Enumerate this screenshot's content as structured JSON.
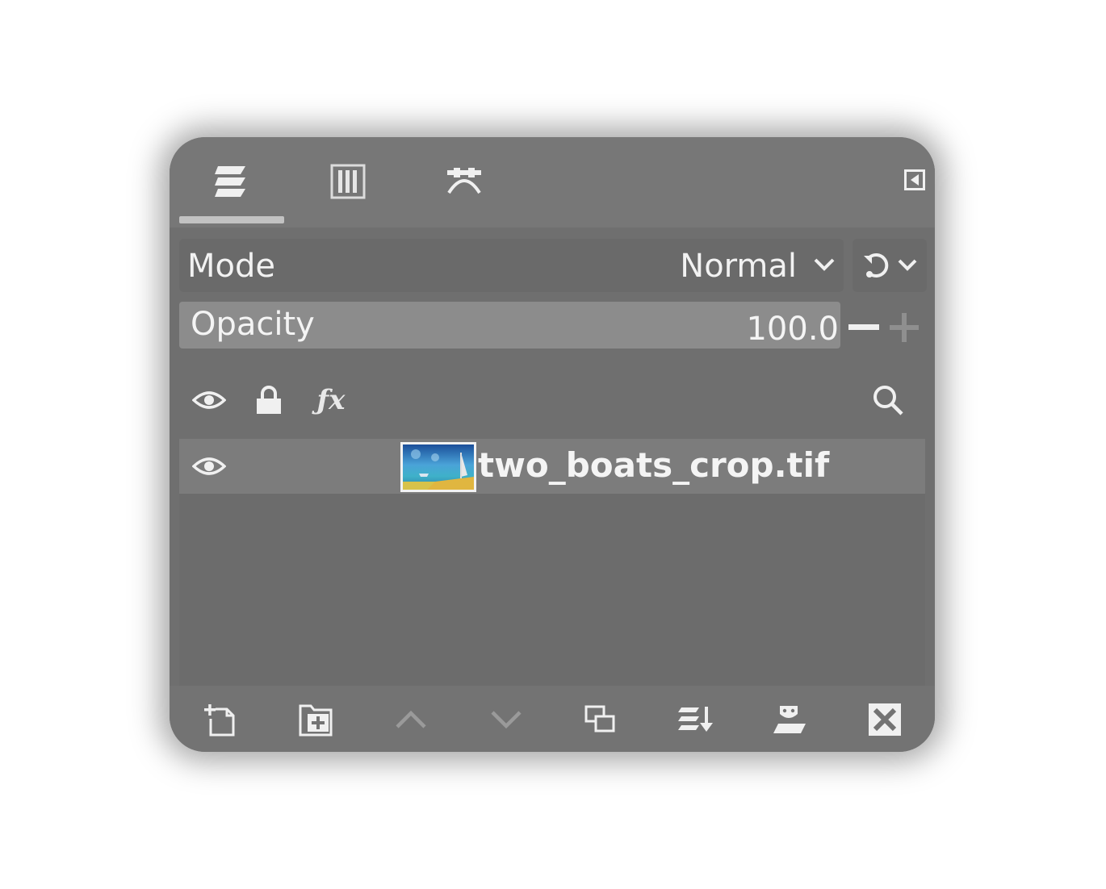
{
  "tabs": [
    {
      "name": "layers",
      "icon": "layers-icon",
      "active": true
    },
    {
      "name": "channels",
      "icon": "channels-icon",
      "active": false
    },
    {
      "name": "paths",
      "icon": "paths-icon",
      "active": false
    }
  ],
  "mode": {
    "label": "Mode",
    "value": "Normal"
  },
  "opacity": {
    "label": "Opacity",
    "value": "100.0",
    "fraction": 1.0
  },
  "layers": [
    {
      "name": "two_boats_crop.tif",
      "visible": true
    }
  ],
  "bottom_actions": [
    "new-layer-icon",
    "new-layer-group-icon",
    "raise-layer-icon",
    "lower-layer-icon",
    "duplicate-layer-icon",
    "merge-layer-icon",
    "add-mask-icon",
    "delete-layer-icon"
  ],
  "colors": {
    "panel": "#6f6f6f",
    "topbar": "#777777",
    "text": "#f2f2f2",
    "selected_row": "#7c7c7c"
  }
}
